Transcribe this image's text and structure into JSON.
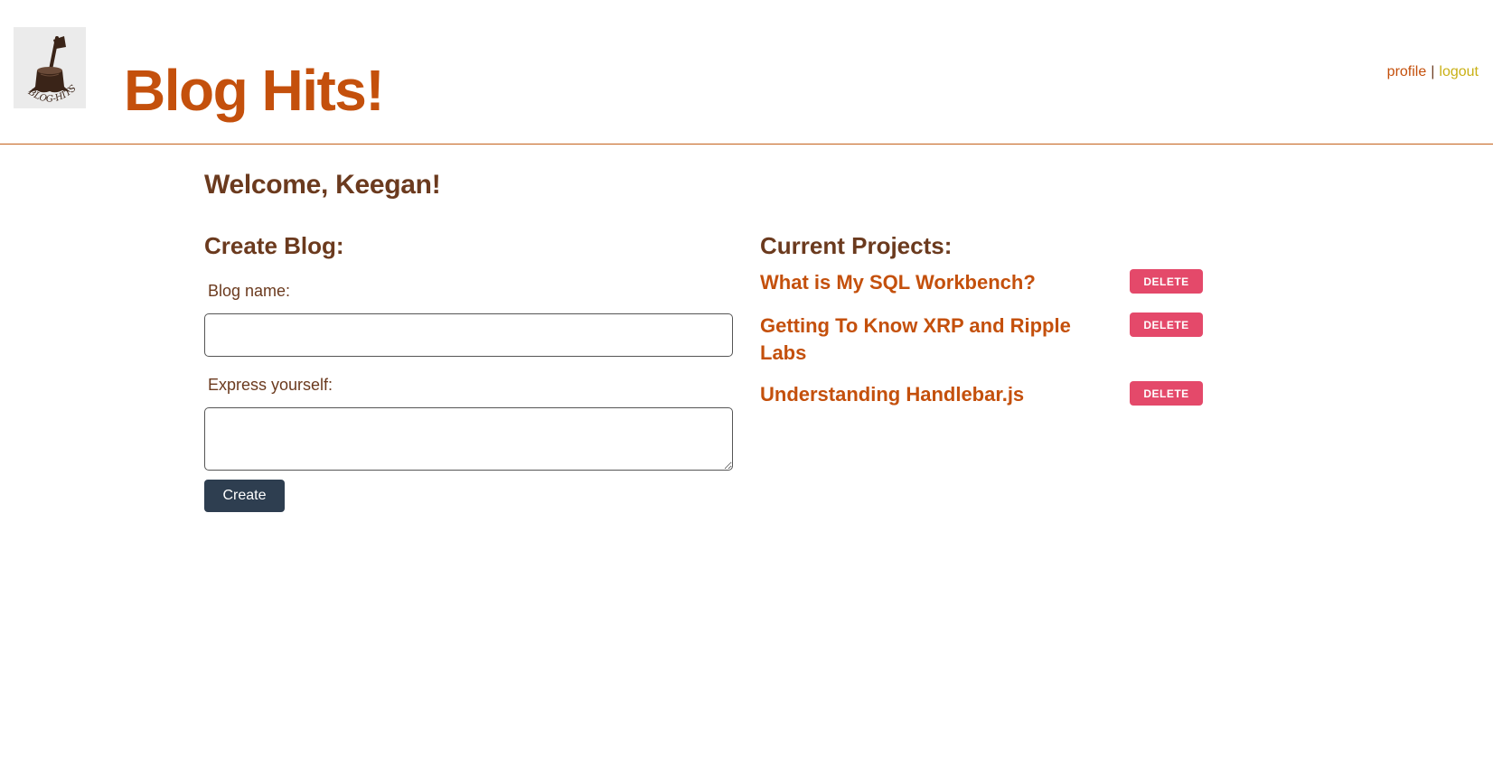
{
  "header": {
    "logo_alt": "BLOG-HITS",
    "brand": "Blog Hits!",
    "nav": {
      "profile": "profile",
      "separator": "|",
      "logout": "logout"
    }
  },
  "welcome": "Welcome, Keegan!",
  "create": {
    "title": "Create Blog:",
    "name_label": "Blog name:",
    "name_value": "",
    "body_label": "Express yourself:",
    "body_value": "",
    "submit_label": "Create"
  },
  "projects": {
    "title": "Current Projects:",
    "items": [
      {
        "title": "What is My SQL Workbench?",
        "delete_label": "DELETE"
      },
      {
        "title": "Getting To Know XRP and Ripple Labs",
        "delete_label": "DELETE"
      },
      {
        "title": "Understanding Handlebar.js",
        "delete_label": "DELETE"
      }
    ]
  },
  "colors": {
    "brand": "#c4500c",
    "heading": "#6b3a1e",
    "logout": "#c9b014",
    "delete": "#e4496a",
    "create_button": "#2e3e50"
  }
}
